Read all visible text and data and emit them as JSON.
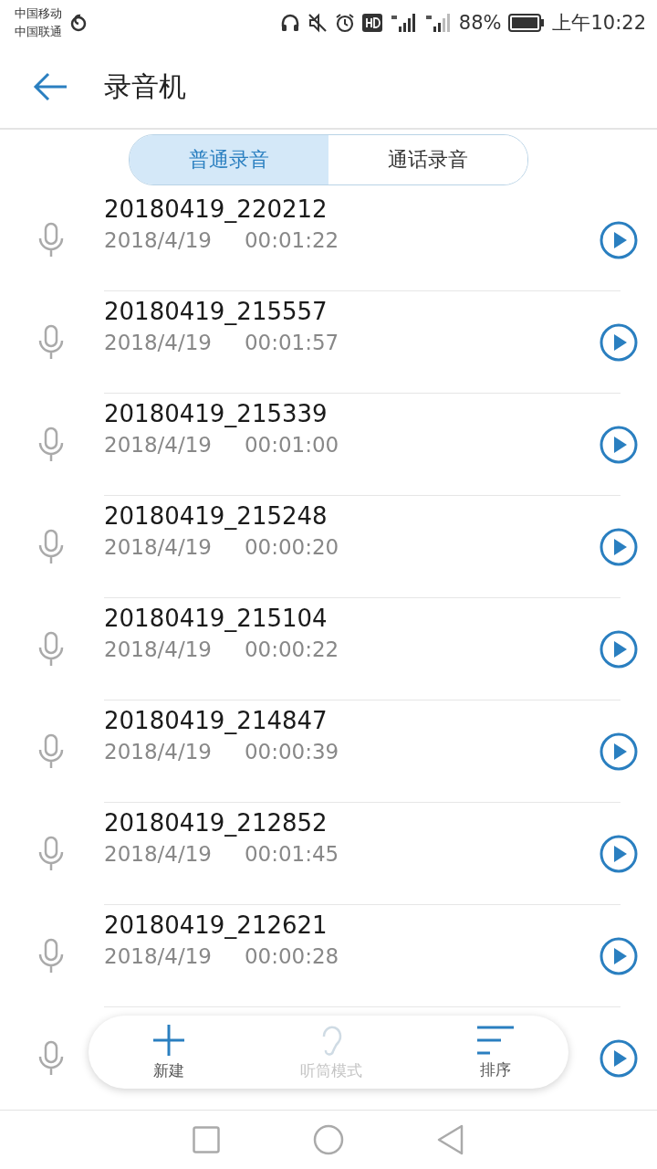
{
  "status_bar": {
    "carriers": [
      "中国移动",
      "中国联通"
    ],
    "battery": "88%",
    "time": "上午10:22"
  },
  "header": {
    "title": "录音机"
  },
  "tabs": [
    {
      "label": "普通录音",
      "selected": true
    },
    {
      "label": "通话录音",
      "selected": false
    }
  ],
  "recordings": [
    {
      "name": "20180419_220212",
      "date": "2018/4/19",
      "duration": "00:01:22"
    },
    {
      "name": "20180419_215557",
      "date": "2018/4/19",
      "duration": "00:01:57"
    },
    {
      "name": "20180419_215339",
      "date": "2018/4/19",
      "duration": "00:01:00"
    },
    {
      "name": "20180419_215248",
      "date": "2018/4/19",
      "duration": "00:00:20"
    },
    {
      "name": "20180419_215104",
      "date": "2018/4/19",
      "duration": "00:00:22"
    },
    {
      "name": "20180419_214847",
      "date": "2018/4/19",
      "duration": "00:00:39"
    },
    {
      "name": "20180419_212852",
      "date": "2018/4/19",
      "duration": "00:01:45"
    },
    {
      "name": "20180419_212621",
      "date": "2018/4/19",
      "duration": "00:00:28"
    }
  ],
  "toolbar": [
    {
      "kind": "new",
      "label": "新建",
      "disabled": false
    },
    {
      "kind": "earpiece",
      "label": "听筒模式",
      "disabled": true
    },
    {
      "kind": "sort",
      "label": "排序",
      "disabled": false
    }
  ]
}
